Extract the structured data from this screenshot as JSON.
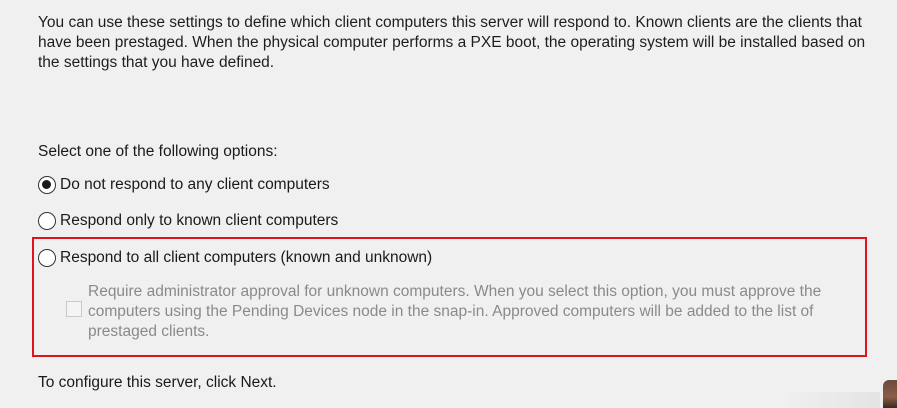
{
  "intro": {
    "text": "You can use these settings to define which client computers this server will respond to. Known clients are the clients that have been prestaged. When the physical computer performs a PXE boot, the operating system will be installed based on the settings that you have defined."
  },
  "prompt": "Select one of the following options:",
  "options": [
    {
      "label": "Do not respond to any client computers",
      "selected": true
    },
    {
      "label": "Respond only to known client computers",
      "selected": false
    },
    {
      "label": "Respond to all client computers (known and unknown)",
      "selected": false
    }
  ],
  "sub_option": {
    "label": "Require administrator approval for unknown computers. When you select this option, you must approve the computers using the Pending Devices node in the snap-in. Approved computers will be added to the list of prestaged clients.",
    "checked": false,
    "enabled": false
  },
  "footer": "To configure this server, click Next.",
  "colors": {
    "highlight_border": "#e0141e",
    "background": "#f0f0f0",
    "disabled_text": "#8a8a8a"
  }
}
